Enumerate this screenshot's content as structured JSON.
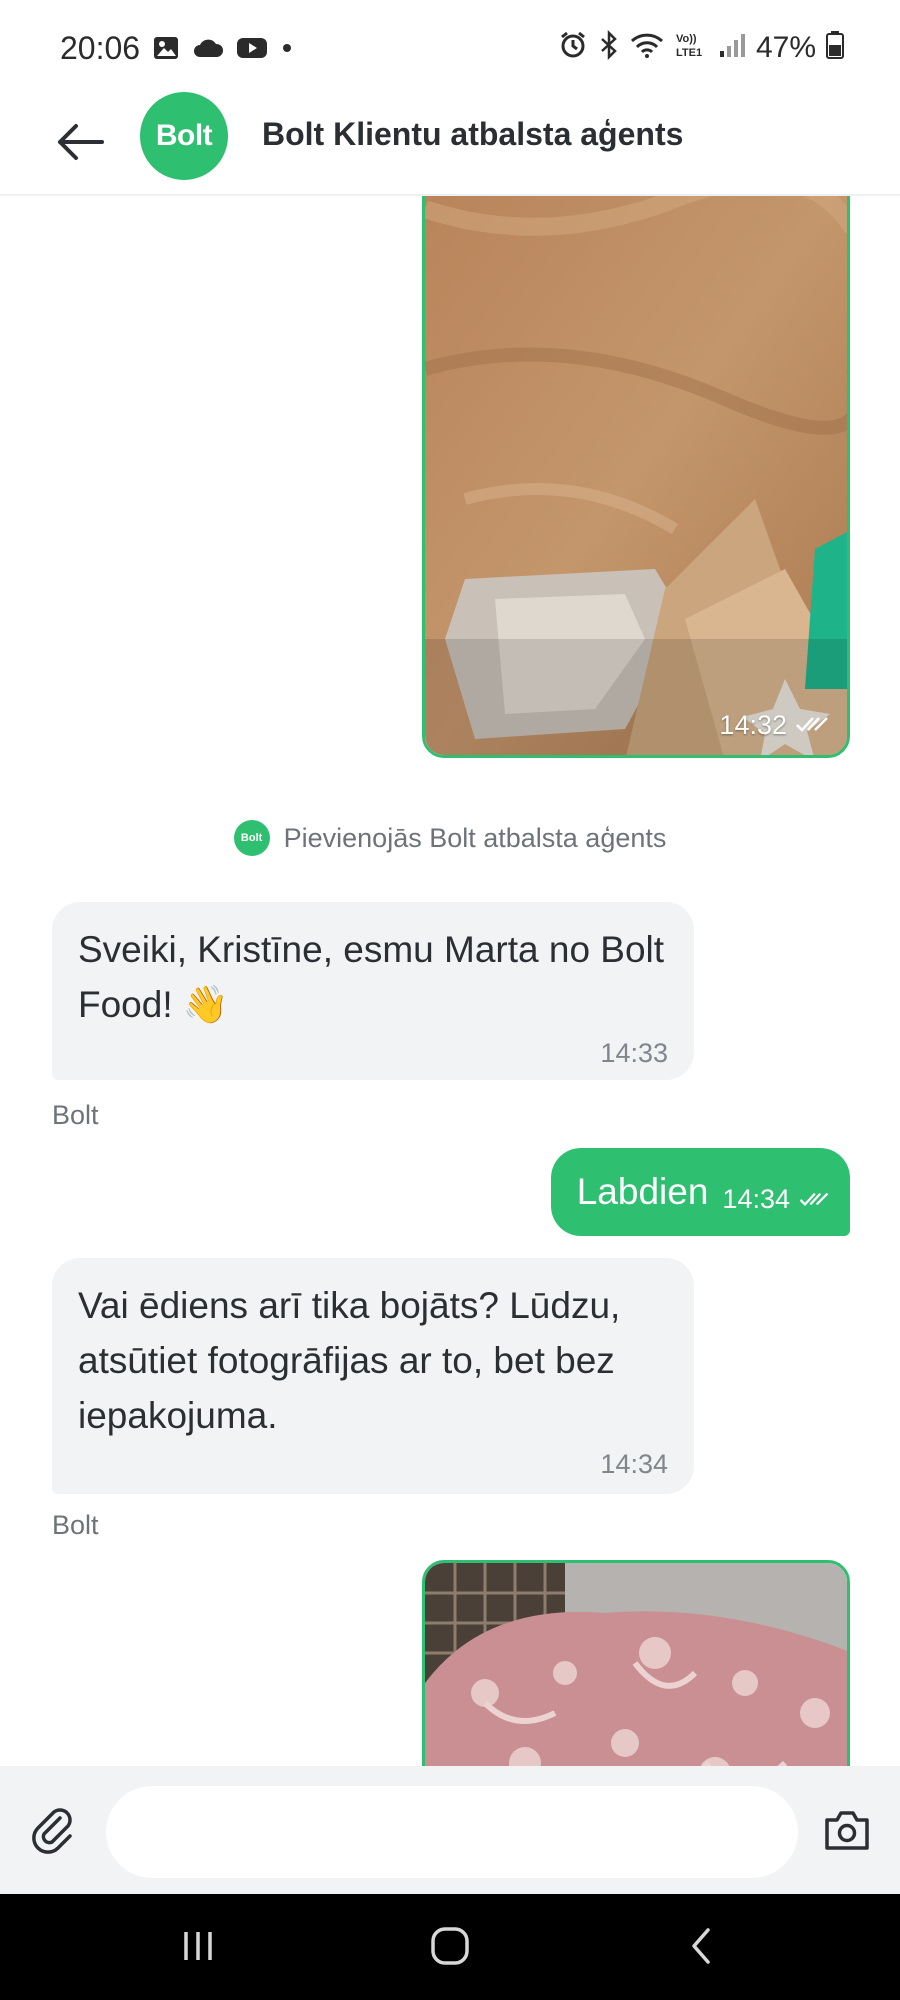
{
  "status_bar": {
    "time": "20:06",
    "battery": "47%",
    "left_icons": [
      "gallery-icon",
      "cloud-icon",
      "youtube-icon",
      "dot-icon"
    ],
    "right_icons": [
      "alarm-icon",
      "bluetooth-icon",
      "wifi-icon",
      "volte-icon",
      "signal-icon",
      "battery-icon"
    ],
    "volte_label": "Vo) LTE1"
  },
  "header": {
    "title": "Bolt Klientu atbalsta aģents",
    "avatar_text": "Bolt",
    "brand_color": "#2fbf71"
  },
  "messages": {
    "image1": {
      "time": "14:32"
    },
    "system_note": {
      "text": "Pievienojās Bolt atbalsta aģents",
      "logo_text": "Bolt"
    },
    "agent1": {
      "text": "Sveiki, Kristīne, esmu Marta no Bolt Food! 👋",
      "time": "14:33",
      "sender": "Bolt"
    },
    "user1": {
      "text": "Labdien",
      "time": "14:34"
    },
    "agent2": {
      "text": "Vai ēdiens arī tika bojāts? Lūdzu, atsūtiet fotogrāfijas ar to, bet bez iepakojuma.",
      "time": "14:34",
      "sender": "Bolt"
    },
    "image2": {}
  },
  "input_bar": {
    "placeholder": ""
  },
  "nav_bar": {
    "icons": [
      "recent-apps-icon",
      "home-icon",
      "back-icon"
    ]
  }
}
